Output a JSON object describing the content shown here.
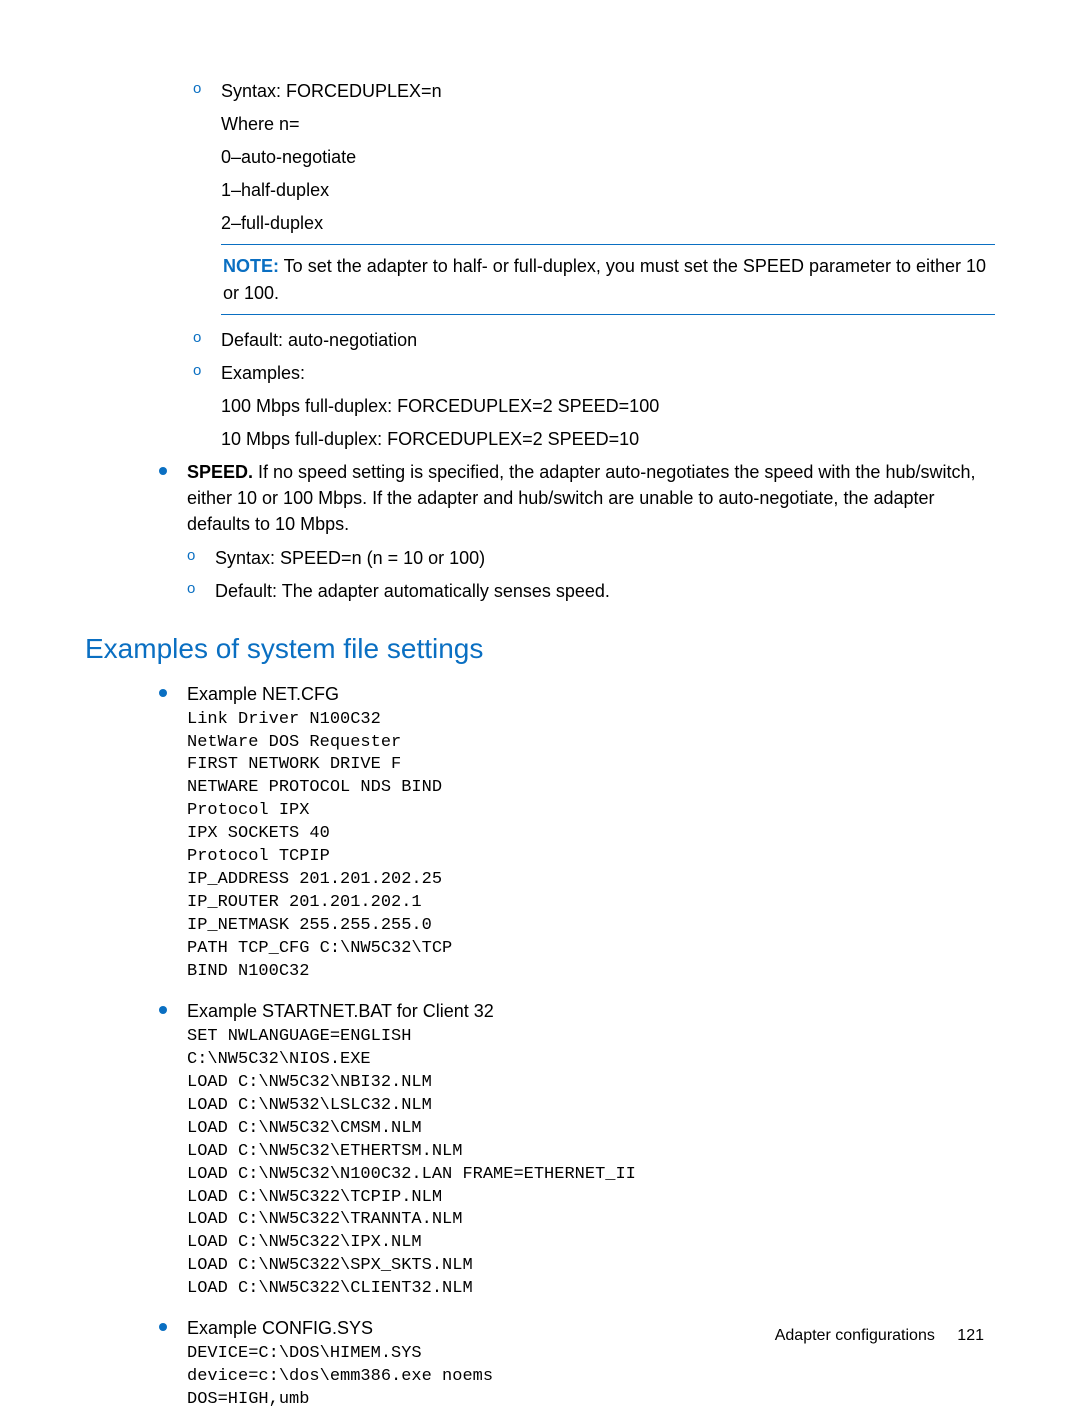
{
  "forceduplex": {
    "syntax": "Syntax: FORCEDUPLEX=n",
    "where": "Where n=",
    "opt0": "0–auto-negotiate",
    "opt1": "1–half-duplex",
    "opt2": "2–full-duplex",
    "note_label": "NOTE:",
    "note_text": "  To set the adapter to half- or full-duplex, you must set the SPEED parameter to either 10 or 100.",
    "default": "Default: auto-negotiation",
    "examples_label": "Examples:",
    "ex1": "100 Mbps full-duplex: FORCEDUPLEX=2 SPEED=100",
    "ex2": "10 Mbps full-duplex: FORCEDUPLEX=2 SPEED=10"
  },
  "speed": {
    "lead": "SPEED.",
    "body": " If no speed setting is specified, the adapter auto-negotiates the speed with the hub/switch, either 10 or 100 Mbps. If the adapter and hub/switch are unable to auto-negotiate, the adapter defaults to 10 Mbps.",
    "syntax": "Syntax: SPEED=n (n = 10 or 100)",
    "default": "Default: The adapter automatically senses speed."
  },
  "section_title": "Examples of system file settings",
  "examples": {
    "netcfg": {
      "head": "Example NET.CFG",
      "code": "Link Driver N100C32\nNetWare DOS Requester\nFIRST NETWORK DRIVE F\nNETWARE PROTOCOL NDS BIND\nProtocol IPX\nIPX SOCKETS 40\nProtocol TCPIP\nIP_ADDRESS 201.201.202.25\nIP_ROUTER 201.201.202.1\nIP_NETMASK 255.255.255.0\nPATH TCP_CFG C:\\NW5C32\\TCP\nBIND N100C32"
    },
    "startnet": {
      "head": "Example STARTNET.BAT for Client 32",
      "code": "SET NWLANGUAGE=ENGLISH\nC:\\NW5C32\\NIOS.EXE\nLOAD C:\\NW5C32\\NBI32.NLM\nLOAD C:\\NW532\\LSLC32.NLM\nLOAD C:\\NW5C32\\CMSM.NLM\nLOAD C:\\NW5C32\\ETHERTSM.NLM\nLOAD C:\\NW5C32\\N100C32.LAN FRAME=ETHERNET_II\nLOAD C:\\NW5C322\\TCPIP.NLM\nLOAD C:\\NW5C322\\TRANNTA.NLM\nLOAD C:\\NW5C322\\IPX.NLM\nLOAD C:\\NW5C322\\SPX_SKTS.NLM\nLOAD C:\\NW5C322\\CLIENT32.NLM"
    },
    "configsys": {
      "head": "Example CONFIG.SYS",
      "code": "DEVICE=C:\\DOS\\HIMEM.SYS\ndevice=c:\\dos\\emm386.exe noems\nDOS=HIGH,umb"
    }
  },
  "footer": {
    "section": "Adapter configurations",
    "page": "121"
  }
}
